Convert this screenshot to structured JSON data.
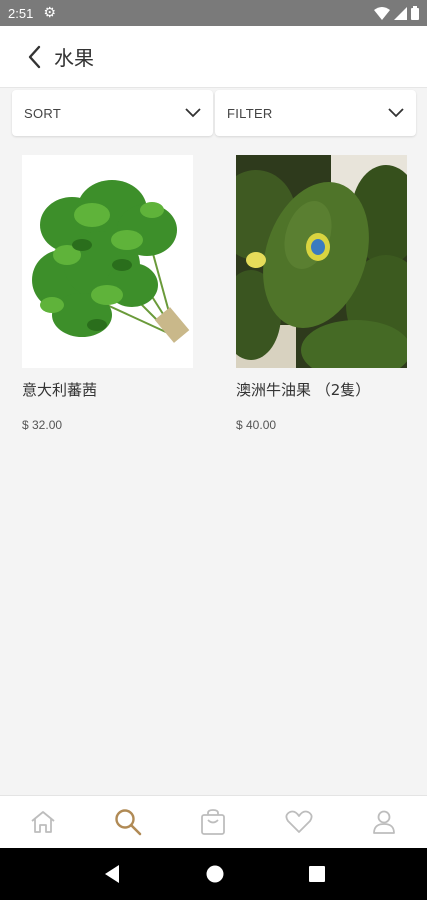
{
  "status_bar": {
    "time": "2:51"
  },
  "header": {
    "title": "水果"
  },
  "controls": {
    "sort_label": "SORT",
    "filter_label": "FILTER"
  },
  "products": [
    {
      "name": "意大利蕃茜",
      "price": "$ 32.00",
      "image": "parsley-photo"
    },
    {
      "name": "澳洲牛油果 （2隻）",
      "price": "$ 40.00",
      "image": "avocado-photo"
    }
  ],
  "bottom_nav": {
    "items": [
      {
        "icon": "home-icon",
        "active": false
      },
      {
        "icon": "search-icon",
        "active": true
      },
      {
        "icon": "shopping-bag-icon",
        "active": false
      },
      {
        "icon": "heart-icon",
        "active": false
      },
      {
        "icon": "user-icon",
        "active": false
      }
    ],
    "active_color": "#b08a55",
    "inactive_color": "#bdbdbd"
  }
}
